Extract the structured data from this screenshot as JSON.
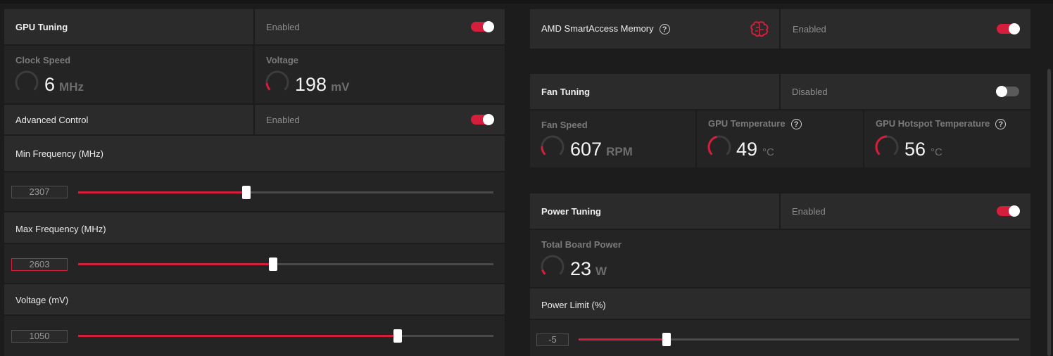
{
  "colors": {
    "accent": "#d41e3c",
    "panel": "#2b2b2b",
    "background": "#1c1c1c"
  },
  "gpu_tuning": {
    "title": "GPU Tuning",
    "state": "Enabled",
    "toggle_on": true,
    "clock_speed": {
      "label": "Clock Speed",
      "value": "6",
      "unit": "MHz",
      "gauge_fraction": 0.0
    },
    "voltage": {
      "label": "Voltage",
      "value": "198",
      "unit": "mV",
      "gauge_fraction": 0.15
    },
    "advanced_control": {
      "label": "Advanced Control",
      "state": "Enabled",
      "toggle_on": true
    },
    "min_frequency": {
      "label": "Min Frequency (MHz)",
      "value": "2307",
      "fraction": 0.405
    },
    "max_frequency": {
      "label": "Max Frequency (MHz)",
      "value": "2603",
      "fraction": 0.47
    },
    "voltage_slider": {
      "label": "Voltage (mV)",
      "value": "1050",
      "fraction": 0.77
    }
  },
  "smart_access_memory": {
    "label": "AMD SmartAccess Memory",
    "help_icon": "question-icon",
    "brain_icon": "brain-icon",
    "state": "Enabled",
    "toggle_on": true
  },
  "fan_tuning": {
    "title": "Fan Tuning",
    "state": "Disabled",
    "toggle_on": false,
    "fan_speed": {
      "label": "Fan Speed",
      "value": "607",
      "unit": "RPM",
      "gauge_fraction": 0.18
    },
    "gpu_temperature": {
      "label": "GPU Temperature",
      "value": "49",
      "unit": "°C",
      "gauge_fraction": 0.45
    },
    "gpu_hotspot_temperature": {
      "label": "GPU Hotspot Temperature",
      "value": "56",
      "unit": "°C",
      "gauge_fraction": 0.5
    }
  },
  "power_tuning": {
    "title": "Power Tuning",
    "state": "Enabled",
    "toggle_on": true,
    "total_board_power": {
      "label": "Total Board Power",
      "value": "23",
      "unit": "W",
      "gauge_fraction": 0.1
    },
    "power_limit": {
      "label": "Power Limit (%)",
      "value": "-5",
      "fraction": 0.2
    }
  }
}
